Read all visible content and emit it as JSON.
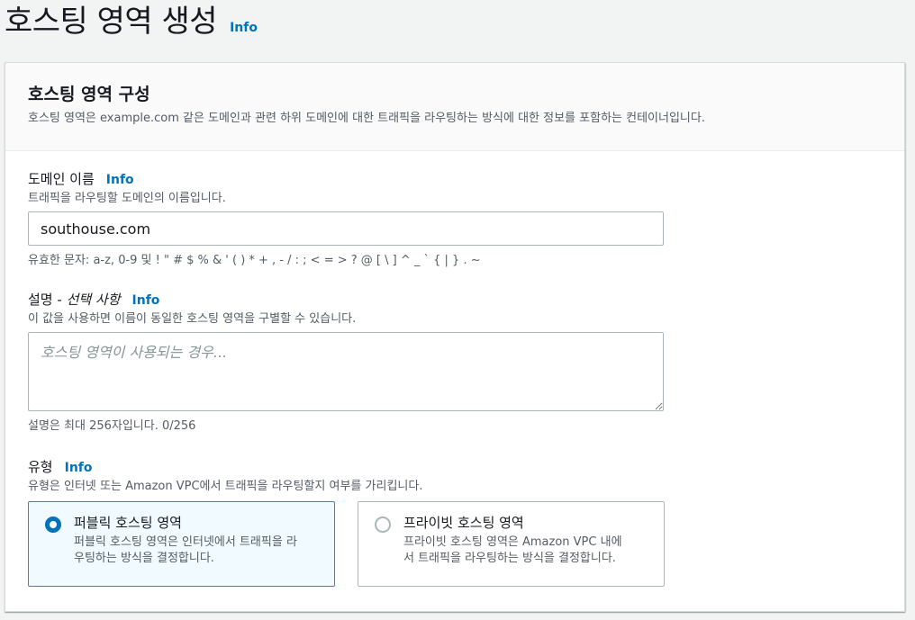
{
  "page": {
    "title": "호스팅 영역 생성",
    "info_label": "Info"
  },
  "panel": {
    "title": "호스팅 영역 구성",
    "description": "호스팅 영역은 example.com 같은 도메인과 관련 하위 도메인에 대한 트래픽을 라우팅하는 방식에 대한 정보를 포함하는 컨테이너입니다."
  },
  "domain": {
    "label": "도메인 이름",
    "info_label": "Info",
    "description": "트래픽을 라우팅할 도메인의 이름입니다.",
    "value": "southouse.com",
    "constraint": "유효한 문자: a-z, 0-9 및 ! \" # $ % & ' ( ) * + , - / : ; < = > ? @ [ \\ ] ^ _ ` { | } . ~"
  },
  "description_field": {
    "label_prefix": "설명 - ",
    "label_optional": "선택 사항",
    "info_label": "Info",
    "description": "이 값을 사용하면 이름이 동일한 호스팅 영역을 구별할 수 있습니다.",
    "value": "",
    "placeholder": "호스팅 영역이 사용되는 경우...",
    "constraint": "설명은 최대 256자입니다. 0/256"
  },
  "type": {
    "label": "유형",
    "info_label": "Info",
    "description": "유형은 인터넷 또는 Amazon VPC에서 트래픽을 라우팅할지 여부를 가리킵니다.",
    "options": [
      {
        "title": "퍼블릭 호스팅 영역",
        "desc_line1": "퍼블릭 호스팅 영역은 인터넷에서 트래픽을 라",
        "desc_line2": "우팅하는 방식을 결정합니다.",
        "selected": true
      },
      {
        "title": "프라이빗 호스팅 영역",
        "desc_line1": "프라이빗 호스팅 영역은 Amazon VPC 내에",
        "desc_line2": "서 트래픽을 라우팅하는 방식을 결정합니다.",
        "selected": false
      }
    ]
  },
  "colors": {
    "link": "#0073bb",
    "selected_border": "#00a1c9",
    "selected_bg": "#f1faff"
  }
}
